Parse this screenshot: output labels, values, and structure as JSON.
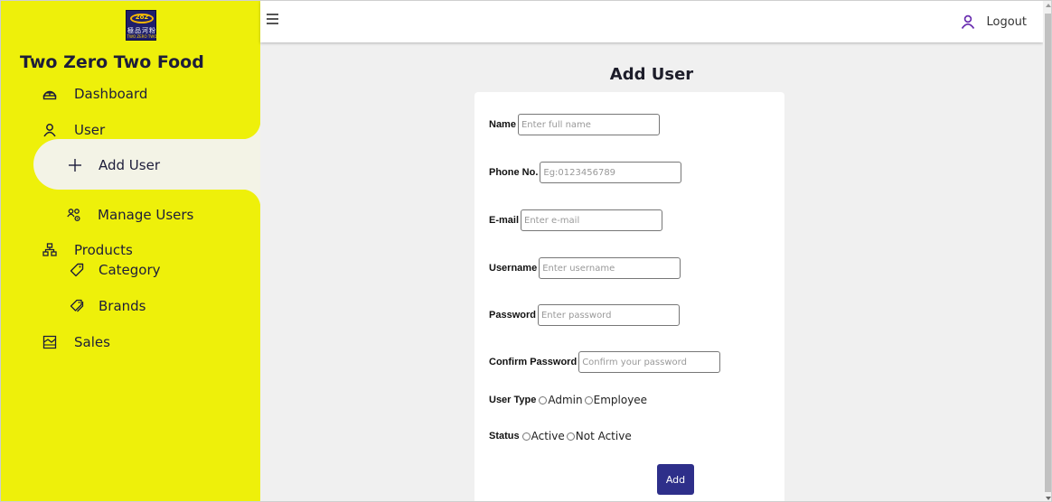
{
  "app": {
    "brand_name": "Two Zero Two Food",
    "logo_text": "2o2",
    "logo_chars": "極品河粉",
    "logo_sub": "TWO ZERO TWO"
  },
  "sidebar": {
    "items": [
      {
        "label": "Dashboard",
        "icon": "dashboard-icon"
      },
      {
        "label": "User",
        "icon": "user-icon"
      },
      {
        "label": "Add User",
        "icon": "plus-icon",
        "active": true
      },
      {
        "label": "Manage Users",
        "icon": "users-gear-icon"
      },
      {
        "label": "Products",
        "icon": "products-icon"
      },
      {
        "label": "Category",
        "icon": "tag-icon"
      },
      {
        "label": "Brands",
        "icon": "tags-icon"
      },
      {
        "label": "Sales",
        "icon": "sales-icon"
      }
    ]
  },
  "topbar": {
    "logout_label": "Logout"
  },
  "form": {
    "title": "Add User",
    "name_label": "Name",
    "name_placeholder": "Enter full name",
    "phone_label": "Phone No.",
    "phone_placeholder": "Eg:0123456789",
    "email_label": "E-mail",
    "email_placeholder": "Enter e-mail",
    "username_label": "Username",
    "username_placeholder": "Enter username",
    "password_label": "Password",
    "password_placeholder": "Enter password",
    "confirm_label": "Confirm Password",
    "confirm_placeholder": "Confirm your password",
    "user_type_label": "User Type",
    "user_type_options": [
      "Admin",
      "Employee"
    ],
    "status_label": "Status",
    "status_options": [
      "Active",
      "Not Active"
    ],
    "submit_label": "Add"
  },
  "colors": {
    "sidebar_bg": "#eef00a",
    "accent": "#2e2f8a",
    "icon_accent": "#6a2fb0"
  }
}
